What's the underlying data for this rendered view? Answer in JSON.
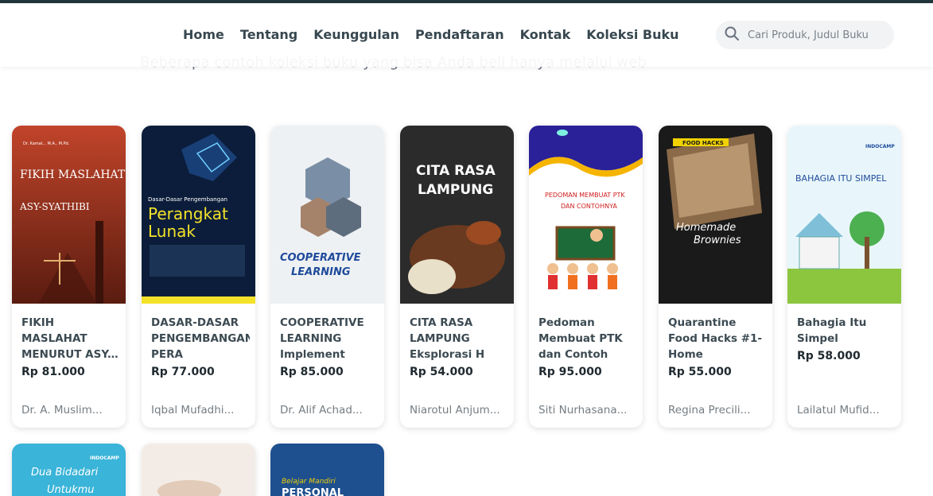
{
  "subtitle": "Beberapa contoh koleksi buku yang bisa Anda beli hanya melalui web",
  "nav": [
    "Home",
    "Tentang",
    "Keunggulan",
    "Pendaftaran",
    "Kontak",
    "Koleksi Buku"
  ],
  "search": {
    "placeholder": "Cari Produk, Judul Buku"
  },
  "products": [
    {
      "title": "FIKIH MASLAHAT MENURUT ASY-SYA",
      "price": "Rp 81.000",
      "author": "Dr. A. Muslim...",
      "cover": {
        "heading": "FIKIH MASLAHAT",
        "sub": "ASY-SYATHIBI",
        "small": "Dr. Kamal... M.A., M.Pd."
      }
    },
    {
      "title": "DASAR-DASAR PENGEMBANGAN PERA",
      "price": "Rp 77.000",
      "author": "Iqbal Mufadhi...",
      "cover": {
        "top": "Dasar-Dasar Pengembangan",
        "heading": "Perangkat",
        "sub": "Lunak"
      }
    },
    {
      "title": "COOPERATIVE LEARNING Implement",
      "price": "Rp 85.000",
      "author": "Dr. Alif Achad...",
      "cover": {
        "heading": "COOPERATIVE",
        "sub": "LEARNING"
      }
    },
    {
      "title": "CITA RASA LAMPUNG Eksplorasi H",
      "price": "Rp 54.000",
      "author": "Niarotul Anjum...",
      "cover": {
        "heading": "CITA RASA",
        "sub": "LAMPUNG"
      }
    },
    {
      "title": "Pedoman Membuat PTK dan Contoh",
      "price": "Rp 95.000",
      "author": "Siti Nurhasana...",
      "cover": {
        "heading": "PEDOMAN MEMBUAT PTK",
        "sub": "DAN CONTOHNYA"
      }
    },
    {
      "title": "Quarantine Food Hacks #1- Home",
      "price": "Rp 55.000",
      "author": "Regina Precili...",
      "cover": {
        "top": "FOOD HACKS",
        "heading": "Homemade",
        "sub": "Brownies"
      }
    },
    {
      "title": "Bahagia Itu Simpel",
      "price": "Rp 58.000",
      "author": "Lailatul Mufid...",
      "cover": {
        "heading": "BAHAGIA ITU SIMPEL",
        "brand": "INDOCAMP"
      }
    }
  ],
  "row2_covers": [
    {
      "heading": "Dua Bidadari",
      "sub": "Untukmu",
      "brand": "INDOCAMP"
    },
    {
      "heading": ""
    },
    {
      "heading": "Belajar Mandiri",
      "sub": "PERSONAL"
    }
  ]
}
